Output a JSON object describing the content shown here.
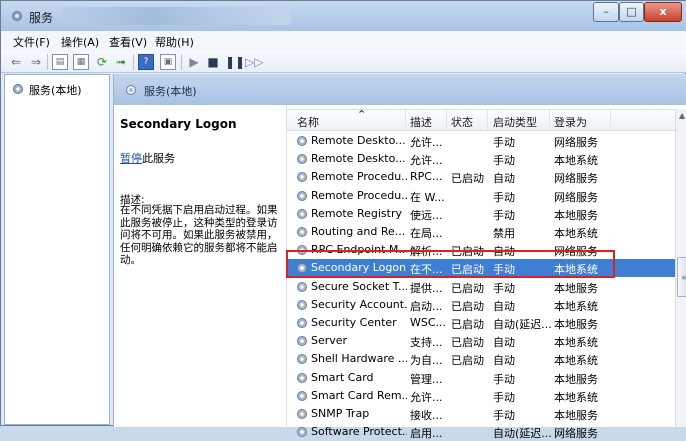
{
  "window": {
    "title": "服务",
    "controls": {
      "minimize": "–",
      "maximize": "□",
      "close": "x"
    }
  },
  "menu": [
    "文件(F)",
    "操作(A)",
    "查看(V)",
    "帮助(H)"
  ],
  "tree": {
    "root_label": "服务(本地)"
  },
  "content_header": {
    "title": "服务(本地)"
  },
  "detail": {
    "service_name": "Secondary Logon",
    "action_link": "暂停",
    "action_suffix": "此服务",
    "description_label": "描述:",
    "description": "在不同凭据下启用启动过程。如果此服务被停止，这种类型的登录访问将不可用。如果此服务被禁用，任何明确依赖它的服务都将不能启动。"
  },
  "list": {
    "columns": {
      "name": "名称",
      "description": "描述",
      "status": "状态",
      "startup_type": "启动类型",
      "logon_as": "登录为"
    },
    "rows": [
      {
        "name": "Remote Deskto...",
        "description": "允许...",
        "status": "",
        "startup_type": "手动",
        "logon_as": "网络服务"
      },
      {
        "name": "Remote Deskto...",
        "description": "允许...",
        "status": "",
        "startup_type": "手动",
        "logon_as": "本地系统"
      },
      {
        "name": "Remote Procedu...",
        "description": "RPC...",
        "status": "已启动",
        "startup_type": "自动",
        "logon_as": "网络服务"
      },
      {
        "name": "Remote Procedu...",
        "description": "在 W...",
        "status": "",
        "startup_type": "手动",
        "logon_as": "网络服务"
      },
      {
        "name": "Remote Registry",
        "description": "使远...",
        "status": "",
        "startup_type": "手动",
        "logon_as": "本地服务"
      },
      {
        "name": "Routing and Re...",
        "description": "在局...",
        "status": "",
        "startup_type": "禁用",
        "logon_as": "本地系统"
      },
      {
        "name": "RPC Endpoint M...",
        "description": "解析...",
        "status": "已启动",
        "startup_type": "自动",
        "logon_as": "网络服务"
      },
      {
        "name": "Secondary Logon",
        "description": "在不...",
        "status": "已启动",
        "startup_type": "手动",
        "logon_as": "本地系统"
      },
      {
        "name": "Secure Socket T...",
        "description": "提供...",
        "status": "已启动",
        "startup_type": "手动",
        "logon_as": "本地服务"
      },
      {
        "name": "Security Account...",
        "description": "启动...",
        "status": "已启动",
        "startup_type": "自动",
        "logon_as": "本地系统"
      },
      {
        "name": "Security Center",
        "description": "WSC...",
        "status": "已启动",
        "startup_type": "自动(延迟...",
        "logon_as": "本地服务"
      },
      {
        "name": "Server",
        "description": "支持...",
        "status": "已启动",
        "startup_type": "自动",
        "logon_as": "本地系统"
      },
      {
        "name": "Shell Hardware ...",
        "description": "为自...",
        "status": "已启动",
        "startup_type": "自动",
        "logon_as": "本地系统"
      },
      {
        "name": "Smart Card",
        "description": "管理...",
        "status": "",
        "startup_type": "手动",
        "logon_as": "本地服务"
      },
      {
        "name": "Smart Card Rem...",
        "description": "允许...",
        "status": "",
        "startup_type": "手动",
        "logon_as": "本地系统"
      },
      {
        "name": "SNMP Trap",
        "description": "接收...",
        "status": "",
        "startup_type": "手动",
        "logon_as": "本地服务"
      },
      {
        "name": "Software Protect...",
        "description": "启用...",
        "status": "",
        "startup_type": "自动(延迟...",
        "logon_as": "网络服务"
      }
    ]
  },
  "colors": {
    "selection": "#3e7fd3",
    "highlight_box": "#e02020",
    "header_band": "#b6cce8"
  }
}
